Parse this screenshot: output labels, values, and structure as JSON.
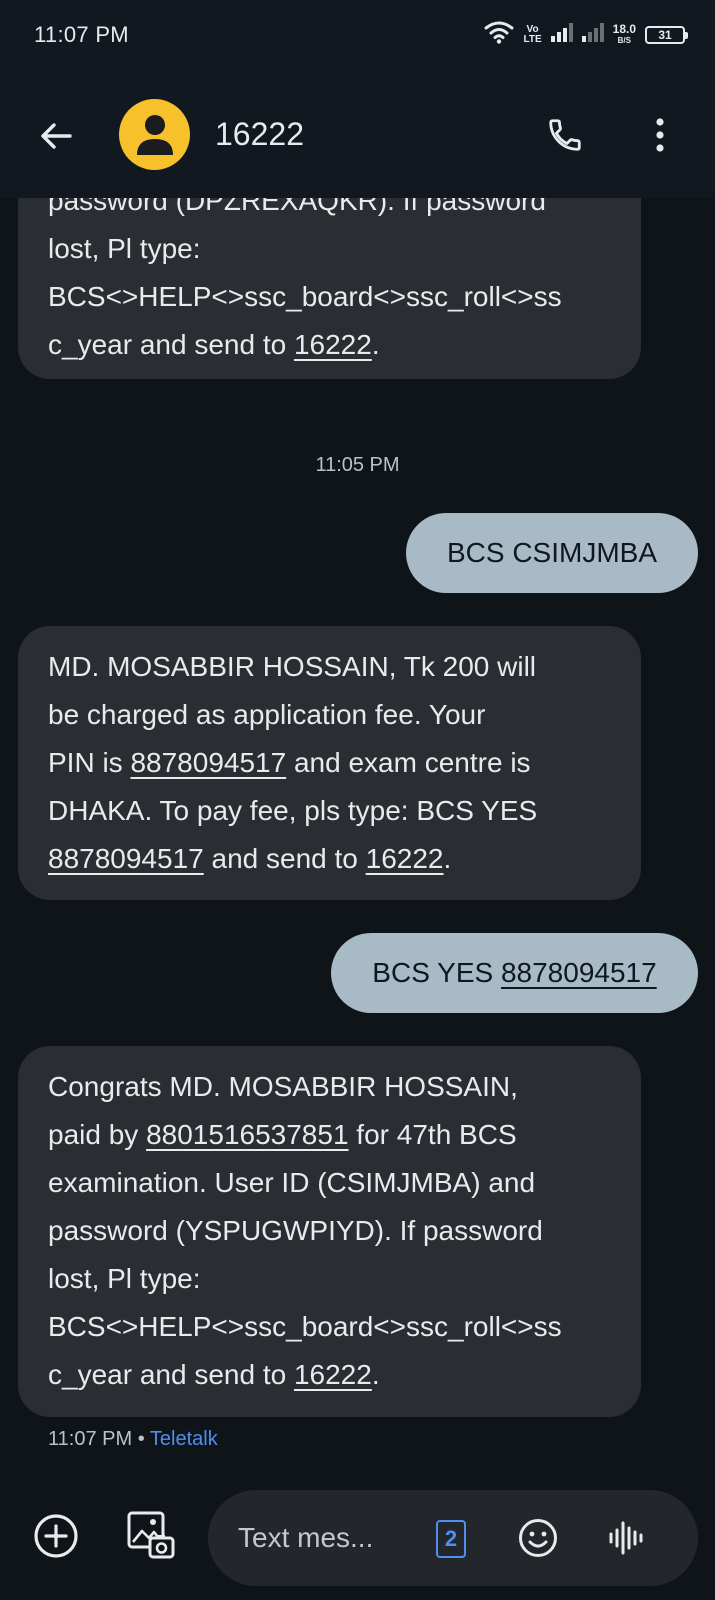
{
  "status_bar": {
    "time": "11:07 PM",
    "volte_top": "Vo",
    "volte_bottom": "LTE",
    "net_speed_value": "18.0",
    "net_speed_unit": "B/S",
    "battery": "31"
  },
  "header": {
    "contact": "16222"
  },
  "messages": {
    "m1": {
      "l1": "password (DPZREXAQKR). If password",
      "l2": "lost, Pl type:",
      "l3": "BCS<>HELP<>ssc_board<>ssc_roll<>ss",
      "l4_pre": "c_year and send to ",
      "l4_link": "16222",
      "l4_post": "."
    },
    "time_separator": "11:05 PM",
    "m2": {
      "text": "BCS CSIMJMBA"
    },
    "m3": {
      "l1": "MD. MOSABBIR HOSSAIN, Tk 200 will",
      "l2": "be charged as application fee. Your",
      "l3_pre": "PIN is ",
      "l3_link": "8878094517",
      "l3_post": " and exam centre is",
      "l4": "DHAKA. To pay fee, pls type: BCS YES",
      "l5_link": "8878094517",
      "l5_mid": " and send to ",
      "l5_link2": "16222",
      "l5_post": "."
    },
    "m4": {
      "pre": "BCS YES ",
      "link": "8878094517"
    },
    "m5": {
      "l1": "Congrats MD. MOSABBIR HOSSAIN,",
      "l2_pre": "paid by ",
      "l2_link": "8801516537851",
      "l2_post": " for 47th BCS",
      "l3": "examination. User ID (CSIMJMBA) and",
      "l4": "password (YSPUGWPIYD). If password",
      "l5": "lost, Pl type:",
      "l6": "BCS<>HELP<>ssc_board<>ssc_roll<>ss",
      "l7_pre": "c_year and send to ",
      "l7_link": "16222",
      "l7_post": "."
    },
    "meta": {
      "time": "11:07 PM",
      "dot": "•",
      "carrier": "Teletalk"
    }
  },
  "compose": {
    "placeholder": "Text mes...",
    "sim": "2"
  },
  "colors": {
    "background": "#0f1419",
    "incoming_bubble": "#2a2e33",
    "outgoing_bubble": "#a9bac7",
    "avatar": "#f6c12a",
    "accent": "#4f8ff0"
  },
  "icons": [
    "wifi-icon",
    "signal-icon",
    "back-arrow-icon",
    "person-icon",
    "phone-icon",
    "more-vert-icon",
    "add-icon",
    "gallery-icon",
    "sim-icon",
    "emoji-icon",
    "voice-icon"
  ]
}
